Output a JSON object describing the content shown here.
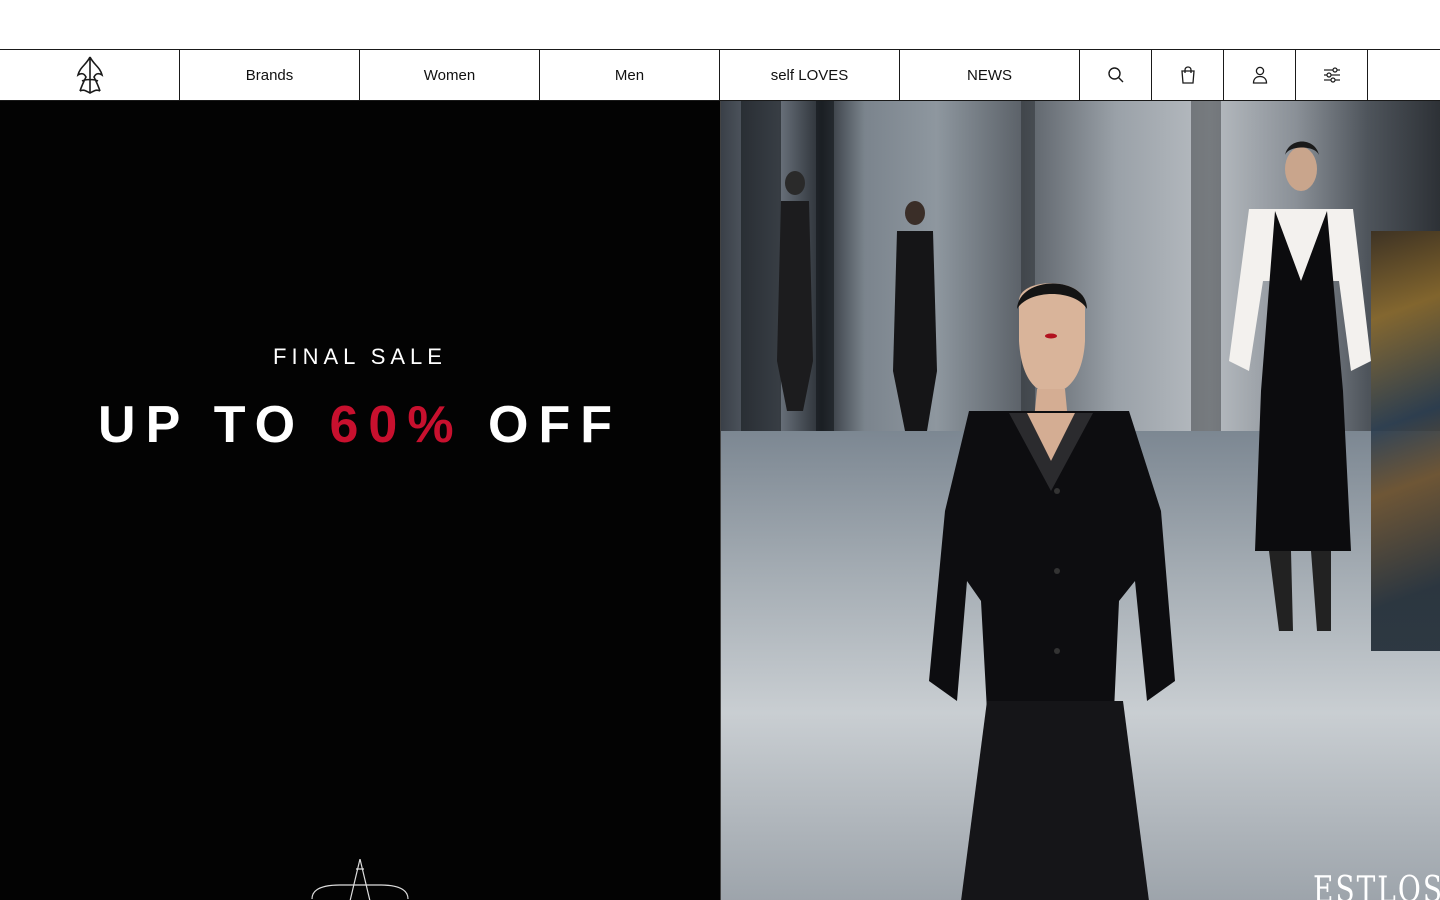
{
  "nav": {
    "links": [
      "Brands",
      "Women",
      "Men",
      "self LOVES",
      "NEWS"
    ],
    "icons": [
      "search-icon",
      "bag-icon",
      "user-icon",
      "sliders-icon"
    ]
  },
  "hero": {
    "kicker": "FINAL SALE",
    "headline_pre": "UP TO ",
    "headline_accent": "60%",
    "headline_post": " OFF",
    "accent_color": "#c8102e",
    "left_bg": "#030303",
    "photo_watermark": "ESTLOS"
  }
}
